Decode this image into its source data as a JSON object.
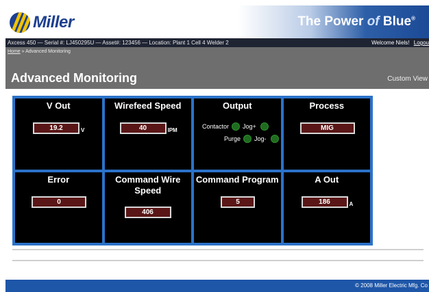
{
  "header": {
    "logo_text": "Miller",
    "tagline_pre": "The Power",
    "tagline_of": "of",
    "tagline_post": "Blue",
    "tagline_reg": "®"
  },
  "infobar": {
    "machine": "Axcess 450 — Serial #: LJ450295U — Asset#: 123456 — Location: Plant 1 Cell 4 Welder 2",
    "welcome": "Welcome Niels!",
    "logout": "Logou"
  },
  "breadcrumb": {
    "home": "Home",
    "separator": " » ",
    "current": "Advanced Monitoring"
  },
  "page_title": "Advanced Monitoring",
  "custom_view": "Custom View",
  "cells": {
    "v_out": {
      "title": "V Out",
      "value": "19.2",
      "unit": "V"
    },
    "wirefeed_speed": {
      "title": "Wirefeed Speed",
      "value": "40",
      "unit": "IPM"
    },
    "output": {
      "title": "Output",
      "contactor": "Contactor",
      "jog_plus": "Jog+",
      "purge": "Purge",
      "jog_minus": "Jog-"
    },
    "process": {
      "title": "Process",
      "value": "MIG"
    },
    "error": {
      "title": "Error",
      "value": "0"
    },
    "command_wire_speed": {
      "title": "Command Wire Speed",
      "value": "406"
    },
    "command_program": {
      "title": "Command Program",
      "value": "5"
    },
    "a_out": {
      "title": "A Out",
      "value": "186",
      "unit": "A"
    }
  },
  "footer": {
    "copyright": "© 2008 Miller Electric Mfg. Co"
  },
  "colors": {
    "brand_blue": "#1d3f8f",
    "grid_border": "#2b72c9",
    "value_bg": "#5a1616",
    "led_green": "#1f6b1f"
  }
}
